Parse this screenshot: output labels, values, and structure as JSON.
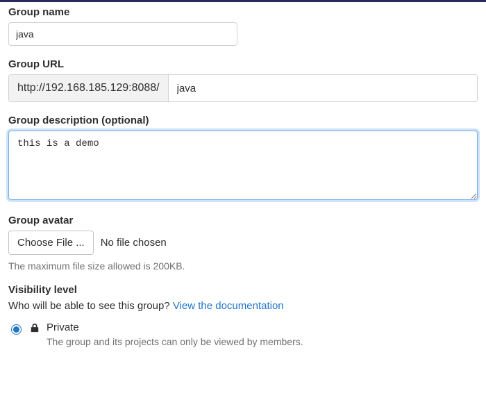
{
  "group_name": {
    "label": "Group name",
    "value": "java"
  },
  "group_url": {
    "label": "Group URL",
    "prefix": "http://192.168.185.129:8088/",
    "value": "java"
  },
  "group_description": {
    "label": "Group description (optional)",
    "value": "this is a demo"
  },
  "group_avatar": {
    "label": "Group avatar",
    "button": "Choose File ...",
    "status": "No file chosen",
    "help": "The maximum file size allowed is 200KB."
  },
  "visibility": {
    "label": "Visibility level",
    "description": "Who will be able to see this group? ",
    "doc_link": "View the documentation",
    "options": {
      "private": {
        "title": "Private",
        "desc": "The group and its projects can only be viewed by members."
      }
    }
  }
}
